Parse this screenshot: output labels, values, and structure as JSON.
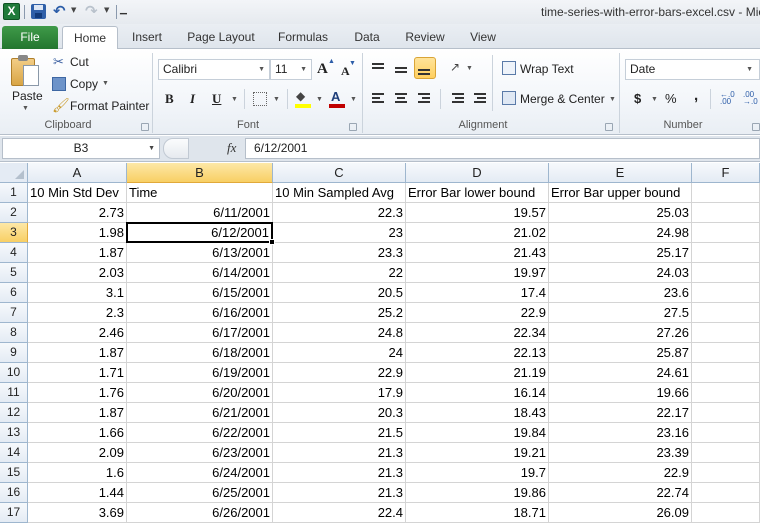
{
  "window": {
    "title": "time-series-with-error-bars-excel.csv  -  Mic"
  },
  "quick_access": {
    "app_icon": "X",
    "save_icon": "save-icon",
    "undo_icon": "undo-icon",
    "redo_icon": "redo-icon",
    "customize_icon": "customize-icon"
  },
  "tabs": [
    {
      "label": "File"
    },
    {
      "label": "Home",
      "active": true
    },
    {
      "label": "Insert"
    },
    {
      "label": "Page Layout"
    },
    {
      "label": "Formulas"
    },
    {
      "label": "Data"
    },
    {
      "label": "Review"
    },
    {
      "label": "View"
    }
  ],
  "ribbon": {
    "clipboard": {
      "label": "Clipboard",
      "paste": "Paste",
      "cut": "Cut",
      "copy": "Copy",
      "format_painter": "Format Painter"
    },
    "font": {
      "label": "Font",
      "font_name": "Calibri",
      "font_size": "11",
      "bold": "B",
      "italic": "I",
      "underline": "U",
      "grow": "A",
      "shrink": "A",
      "fill_color": "#ffff00",
      "font_color": "#c00000"
    },
    "alignment": {
      "label": "Alignment",
      "wrap_text": "Wrap Text",
      "merge_center": "Merge & Center"
    },
    "number": {
      "label": "Number",
      "format": "Date",
      "currency": "$",
      "percent": "%",
      "comma": ",",
      "inc_decimal": ".00",
      "dec_decimal": ".0"
    }
  },
  "formula_bar": {
    "name_box": "B3",
    "fx": "fx",
    "value": "6/12/2001"
  },
  "sheet": {
    "columns": [
      "A",
      "B",
      "C",
      "D",
      "E",
      "F"
    ],
    "selected_cell": "B3",
    "header_row": [
      "10 Min Std Dev",
      "Time",
      "10 Min Sampled Avg",
      "Error Bar lower bound",
      "Error Bar upper bound",
      ""
    ],
    "rows": [
      {
        "n": "2",
        "cells": [
          "2.73",
          "6/11/2001",
          "22.3",
          "19.57",
          "25.03",
          ""
        ]
      },
      {
        "n": "3",
        "cells": [
          "1.98",
          "6/12/2001",
          "23",
          "21.02",
          "24.98",
          ""
        ]
      },
      {
        "n": "4",
        "cells": [
          "1.87",
          "6/13/2001",
          "23.3",
          "21.43",
          "25.17",
          ""
        ]
      },
      {
        "n": "5",
        "cells": [
          "2.03",
          "6/14/2001",
          "22",
          "19.97",
          "24.03",
          ""
        ]
      },
      {
        "n": "6",
        "cells": [
          "3.1",
          "6/15/2001",
          "20.5",
          "17.4",
          "23.6",
          ""
        ]
      },
      {
        "n": "7",
        "cells": [
          "2.3",
          "6/16/2001",
          "25.2",
          "22.9",
          "27.5",
          ""
        ]
      },
      {
        "n": "8",
        "cells": [
          "2.46",
          "6/17/2001",
          "24.8",
          "22.34",
          "27.26",
          ""
        ]
      },
      {
        "n": "9",
        "cells": [
          "1.87",
          "6/18/2001",
          "24",
          "22.13",
          "25.87",
          ""
        ]
      },
      {
        "n": "10",
        "cells": [
          "1.71",
          "6/19/2001",
          "22.9",
          "21.19",
          "24.61",
          ""
        ]
      },
      {
        "n": "11",
        "cells": [
          "1.76",
          "6/20/2001",
          "17.9",
          "16.14",
          "19.66",
          ""
        ]
      },
      {
        "n": "12",
        "cells": [
          "1.87",
          "6/21/2001",
          "20.3",
          "18.43",
          "22.17",
          ""
        ]
      },
      {
        "n": "13",
        "cells": [
          "1.66",
          "6/22/2001",
          "21.5",
          "19.84",
          "23.16",
          ""
        ]
      },
      {
        "n": "14",
        "cells": [
          "2.09",
          "6/23/2001",
          "21.3",
          "19.21",
          "23.39",
          ""
        ]
      },
      {
        "n": "15",
        "cells": [
          "1.6",
          "6/24/2001",
          "21.3",
          "19.7",
          "22.9",
          ""
        ]
      },
      {
        "n": "16",
        "cells": [
          "1.44",
          "6/25/2001",
          "21.3",
          "19.86",
          "22.74",
          ""
        ]
      },
      {
        "n": "17",
        "cells": [
          "3.69",
          "6/26/2001",
          "22.4",
          "18.71",
          "26.09",
          ""
        ]
      }
    ]
  }
}
